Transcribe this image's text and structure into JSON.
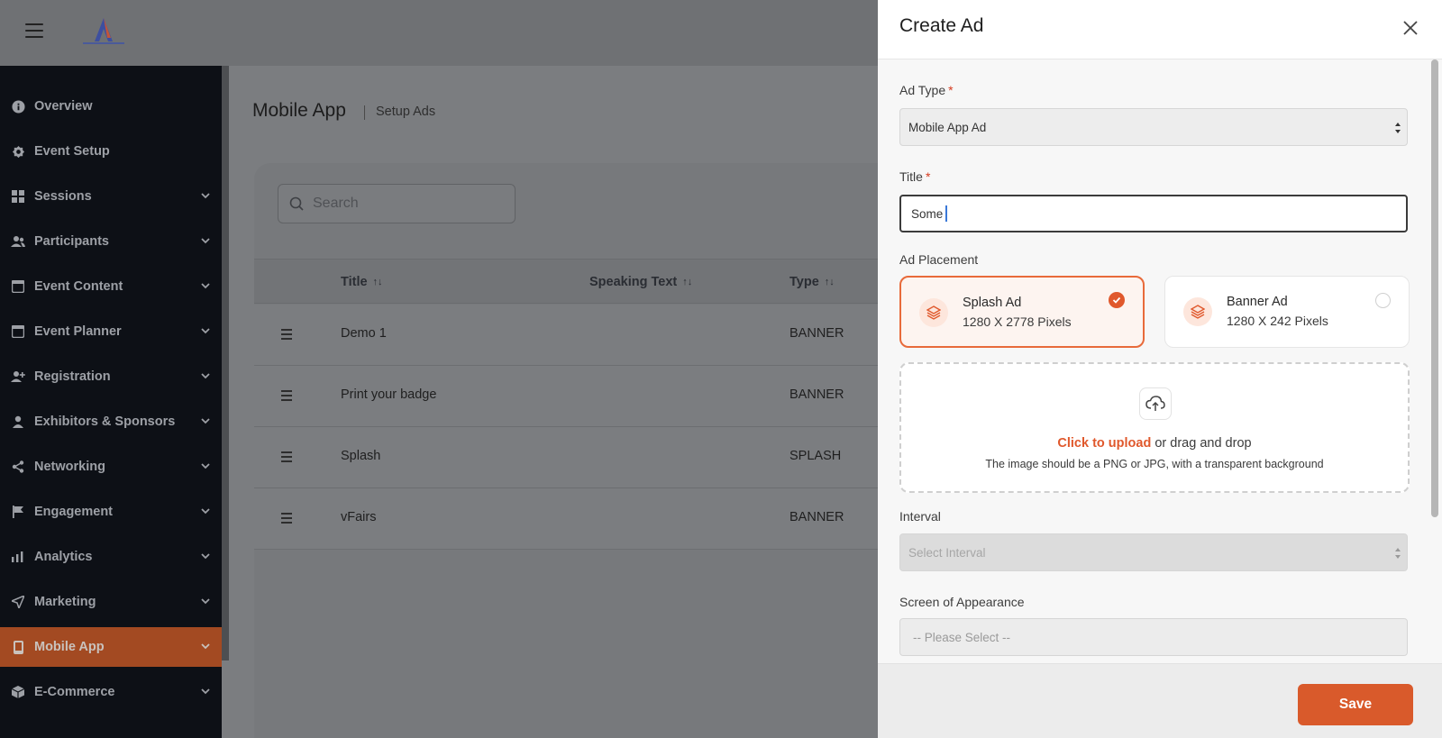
{
  "colors": {
    "accent": "#d95a2b",
    "sidebar_bg": "#0d1016",
    "active_item_bg": "#a34a22"
  },
  "topbar": {
    "menu_icon": "hamburger-menu-icon",
    "logo_icon": "event-logo-icon"
  },
  "sidebar": {
    "items": [
      {
        "label": "Overview",
        "icon": "info-icon",
        "has_chevron": false
      },
      {
        "label": "Event Setup",
        "icon": "gear-icon",
        "has_chevron": false
      },
      {
        "label": "Sessions",
        "icon": "grid-icon",
        "has_chevron": true
      },
      {
        "label": "Participants",
        "icon": "users-icon",
        "has_chevron": true
      },
      {
        "label": "Event Content",
        "icon": "window-icon",
        "has_chevron": true
      },
      {
        "label": "Event Planner",
        "icon": "window-icon",
        "has_chevron": true
      },
      {
        "label": "Registration",
        "icon": "user-plus-icon",
        "has_chevron": true
      },
      {
        "label": "Exhibitors & Sponsors",
        "icon": "user-icon",
        "has_chevron": true
      },
      {
        "label": "Networking",
        "icon": "share-icon",
        "has_chevron": true
      },
      {
        "label": "Engagement",
        "icon": "flag-icon",
        "has_chevron": true
      },
      {
        "label": "Analytics",
        "icon": "bar-chart-icon",
        "has_chevron": true
      },
      {
        "label": "Marketing",
        "icon": "send-icon",
        "has_chevron": true
      },
      {
        "label": "Mobile App",
        "icon": "mobile-icon",
        "has_chevron": true,
        "active": true
      },
      {
        "label": "E-Commerce",
        "icon": "box-icon",
        "has_chevron": true
      }
    ]
  },
  "page": {
    "title": "Mobile App",
    "subtitle": "Setup Ads"
  },
  "search": {
    "placeholder": "Search"
  },
  "table": {
    "columns": [
      {
        "label": "Title",
        "sort_icon": "sort-arrows-icon"
      },
      {
        "label": "Speaking Text",
        "sort_icon": "sort-arrows-icon"
      },
      {
        "label": "Type",
        "sort_icon": "sort-arrows-icon"
      }
    ],
    "rows": [
      {
        "title": "Demo 1",
        "type": "BANNER"
      },
      {
        "title": "Print your badge",
        "type": "BANNER"
      },
      {
        "title": "Splash",
        "type": "SPLASH"
      },
      {
        "title": "vFairs",
        "type": "BANNER"
      }
    ]
  },
  "modal": {
    "title": "Create Ad",
    "close_icon": "close-icon",
    "ad_type": {
      "label": "Ad Type",
      "required": "*",
      "value": "Mobile App Ad"
    },
    "title_field": {
      "label": "Title",
      "required": "*",
      "value": "Some"
    },
    "ad_placement": {
      "label": "Ad Placement",
      "options": [
        {
          "name": "Splash Ad",
          "size": "1280 X 2778 Pixels",
          "selected": true,
          "icon": "layers-icon"
        },
        {
          "name": "Banner Ad",
          "size": "1280 X 242 Pixels",
          "selected": false,
          "icon": "layers-icon"
        }
      ]
    },
    "upload": {
      "icon": "upload-cloud-icon",
      "link": "Click to upload",
      "text": " or drag and drop",
      "hint": "The image should be a PNG or JPG, with a transparent background"
    },
    "interval": {
      "label": "Interval",
      "placeholder": "Select Interval"
    },
    "screen_of_appearance": {
      "label": "Screen of Appearance",
      "placeholder": "-- Please Select --"
    },
    "save_label": "Save"
  }
}
